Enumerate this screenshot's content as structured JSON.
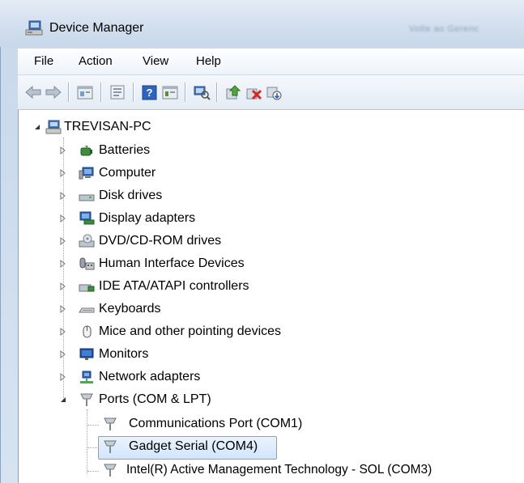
{
  "window": {
    "title": "Device Manager",
    "title_blurred_right": "Volte ao Gerenc"
  },
  "menu": [
    "File",
    "Action",
    "View",
    "Help"
  ],
  "toolbar": [
    "back-icon",
    "forward-icon",
    "properties-list-icon",
    "properties-icon",
    "help-icon",
    "update-driver-icon",
    "scan-hardware-icon",
    "update-driver-software-icon",
    "uninstall-icon",
    "enable-device-icon"
  ],
  "tree": {
    "root": "TREVISAN-PC",
    "categories": [
      {
        "label": "Batteries",
        "icon": "battery-icon"
      },
      {
        "label": "Computer",
        "icon": "computer-icon"
      },
      {
        "label": "Disk drives",
        "icon": "disk-drive-icon"
      },
      {
        "label": "Display adapters",
        "icon": "display-adapter-icon"
      },
      {
        "label": "DVD/CD-ROM drives",
        "icon": "dvd-drive-icon"
      },
      {
        "label": "Human Interface Devices",
        "icon": "hid-icon"
      },
      {
        "label": "IDE ATA/ATAPI controllers",
        "icon": "ide-controller-icon"
      },
      {
        "label": "Keyboards",
        "icon": "keyboard-icon"
      },
      {
        "label": "Mice and other pointing devices",
        "icon": "mouse-icon"
      },
      {
        "label": "Monitors",
        "icon": "monitor-icon"
      },
      {
        "label": "Network adapters",
        "icon": "network-adapter-icon"
      },
      {
        "label": "Ports (COM & LPT)",
        "icon": "port-icon"
      }
    ],
    "ports_children": [
      {
        "label": "Communications Port (COM1)",
        "icon": "port-icon"
      },
      {
        "label": "Gadget Serial (COM4)",
        "icon": "port-icon",
        "selected": true
      },
      {
        "label": "Intel(R) Active Management Technology - SOL (COM3)",
        "icon": "port-icon"
      }
    ]
  },
  "colors": {
    "selection_border": "#7da2ce",
    "selection_fill": "#d2e5fb",
    "chrome": "#d6e3f1"
  }
}
